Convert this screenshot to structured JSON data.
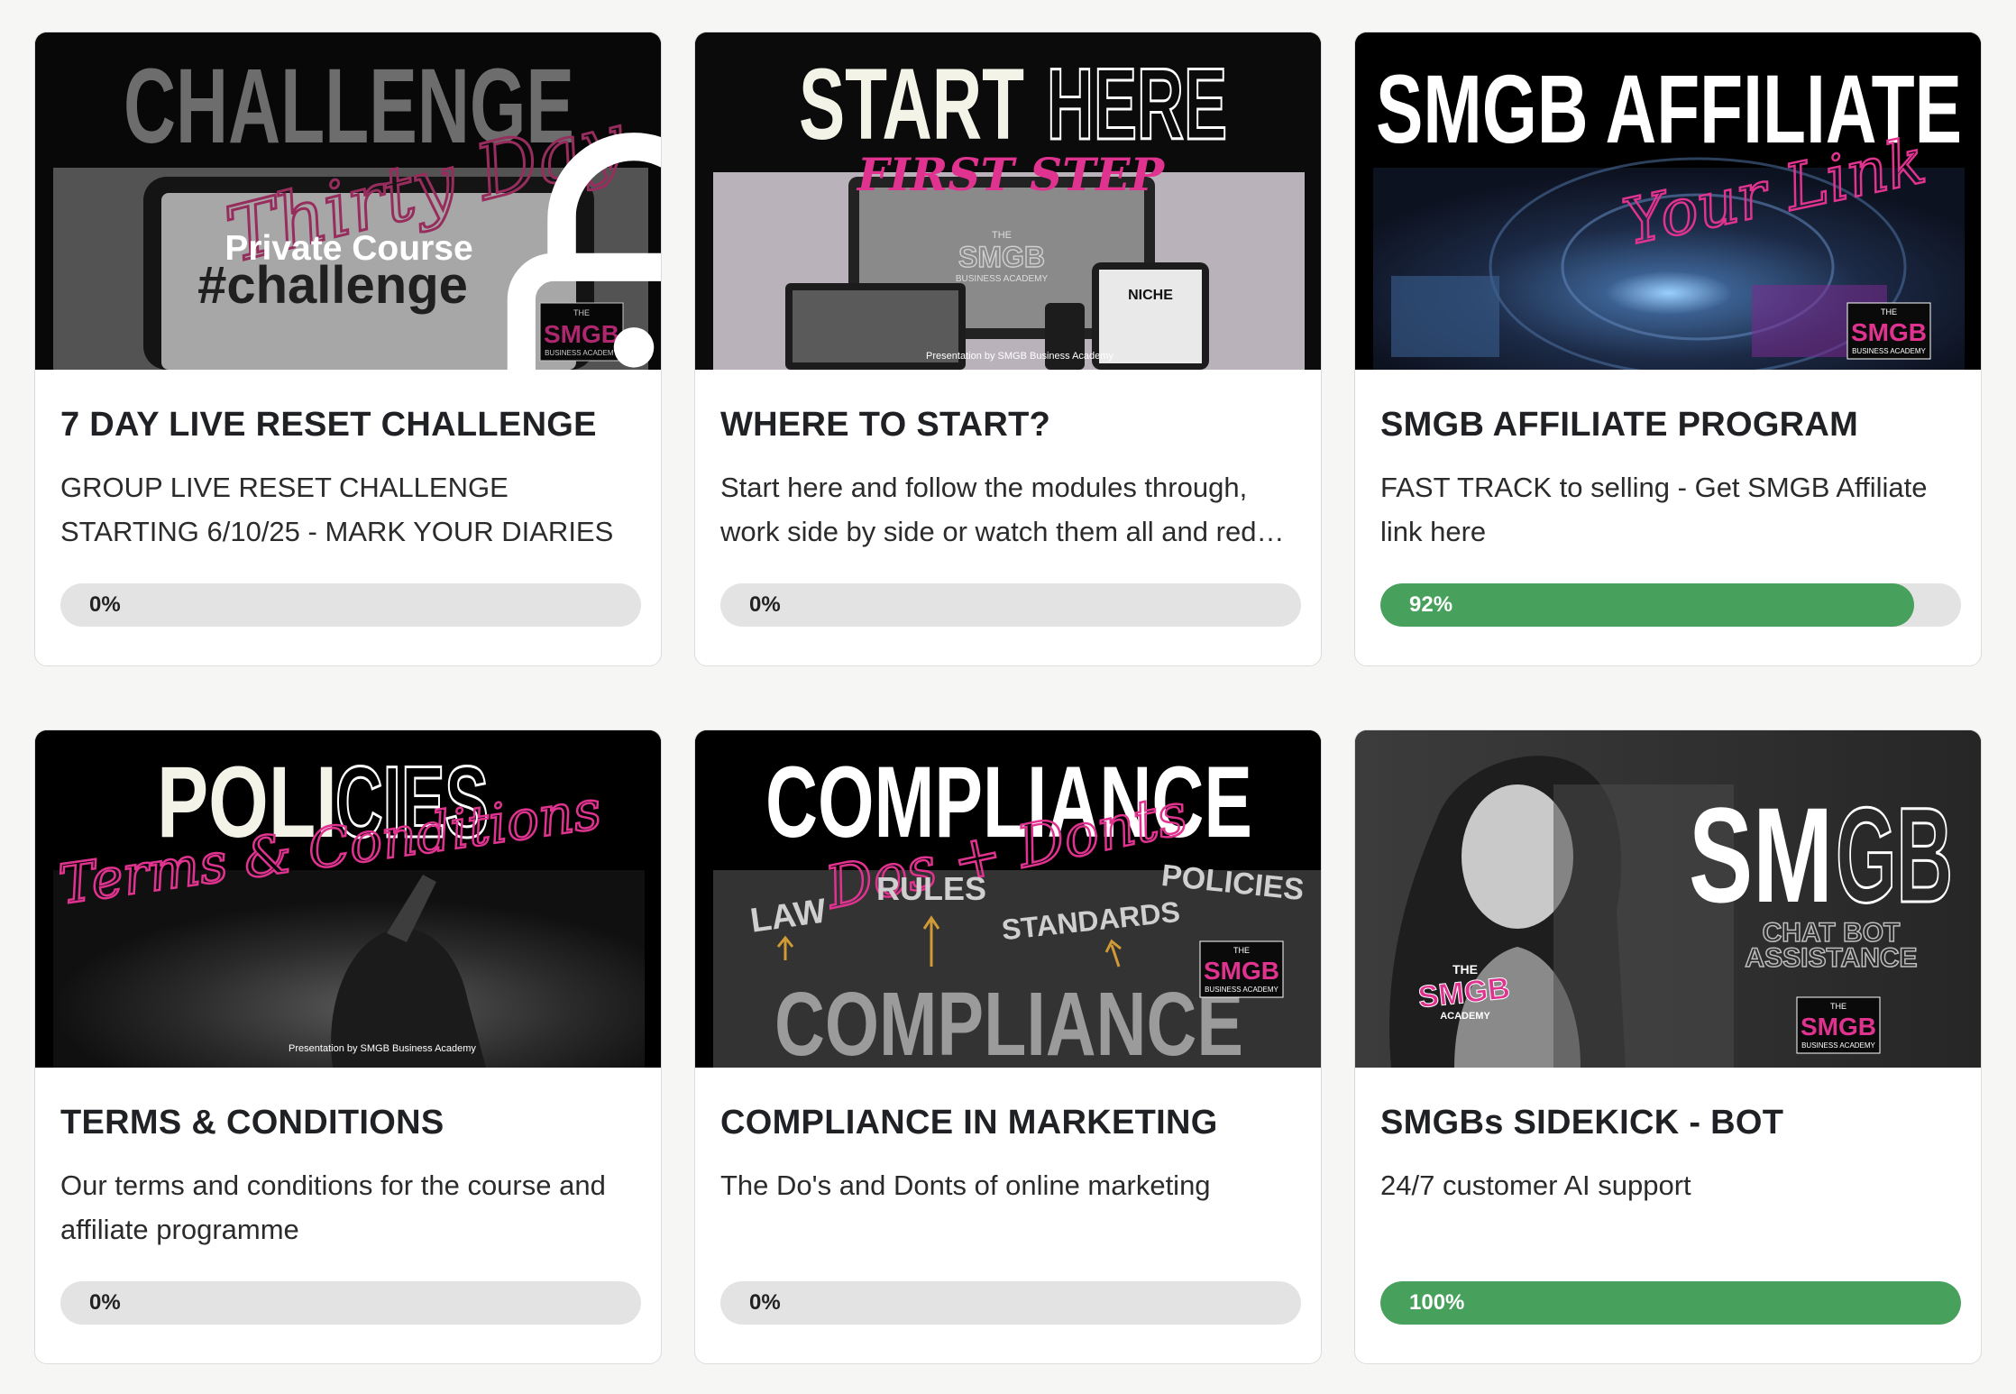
{
  "courses": [
    {
      "title": "7 DAY LIVE RESET CHALLENGE",
      "description": "GROUP LIVE RESET CHALLENGE STARTING 6/10/25 - MARK YOUR DIARIES",
      "progress": 0,
      "progress_label": "0%",
      "locked": true,
      "lock_label": "Private Course",
      "thumb": {
        "headline": "CHALLENGE",
        "script": "Thirty Day",
        "hashtag": "#challenge",
        "badge_top": "THE",
        "badge_main": "SMGB",
        "badge_sub": "BUSINESS ACADEMY"
      }
    },
    {
      "title": "WHERE TO START?",
      "description": "Start here and follow the modules through, work side by side or watch them all and red…",
      "progress": 0,
      "progress_label": "0%",
      "locked": false,
      "thumb": {
        "headline_a": "START",
        "headline_b": "HERE",
        "script": "FIRST STEP",
        "footer": "Presentation by SMGB Business Academy",
        "badge_top": "THE",
        "badge_main": "SMGB",
        "badge_sub": "BUSINESS ACADEMY",
        "tablet_text": "NICHE"
      }
    },
    {
      "title": "SMGB AFFILIATE PROGRAM",
      "description": "FAST TRACK to selling - Get SMGB Affiliate link here",
      "progress": 92,
      "progress_label": "92%",
      "locked": false,
      "thumb": {
        "headline": "SMGB AFFILIATE",
        "script": "Your Link",
        "badge_top": "THE",
        "badge_main": "SMGB",
        "badge_sub": "BUSINESS ACADEMY"
      }
    },
    {
      "title": "TERMS & CONDITIONS",
      "description": "Our terms and conditions for the course and affiliate programme",
      "progress": 0,
      "progress_label": "0%",
      "locked": false,
      "thumb": {
        "headline_a": "POLI",
        "headline_b": "CIES",
        "script": "Terms & Conditions",
        "footer": "Presentation by SMGB Business Academy"
      }
    },
    {
      "title": "COMPLIANCE IN MARKETING",
      "description": "The Do's and Donts of online marketing",
      "progress": 0,
      "progress_label": "0%",
      "locked": false,
      "thumb": {
        "headline": "COMPLIANCE",
        "script": "Dos + Donts",
        "word1": "LAW",
        "word2": "RULES",
        "word3": "STANDARDS",
        "word4": "POLICIES",
        "big": "COMPLIANCE",
        "badge_top": "THE",
        "badge_main": "SMGB",
        "badge_sub": "BUSINESS ACADEMY"
      }
    },
    {
      "title": "SMGBs SIDEKICK - BOT",
      "description": "24/7 customer AI support",
      "progress": 100,
      "progress_label": "100%",
      "locked": false,
      "thumb": {
        "headline_a": "SM",
        "headline_b": "GB",
        "sub1": "CHAT BOT",
        "sub2": "ASSISTANCE",
        "chest_top": "THE",
        "chest_main": "SMGB",
        "chest_sub": "ACADEMY",
        "badge_top": "THE",
        "badge_main": "SMGB",
        "badge_sub": "BUSINESS ACADEMY"
      }
    }
  ],
  "colors": {
    "accent_pink": "#e0338f",
    "progress_green": "#47a05b",
    "track_grey": "#e3e3e3"
  },
  "icons": {
    "lock": "lock-icon"
  }
}
